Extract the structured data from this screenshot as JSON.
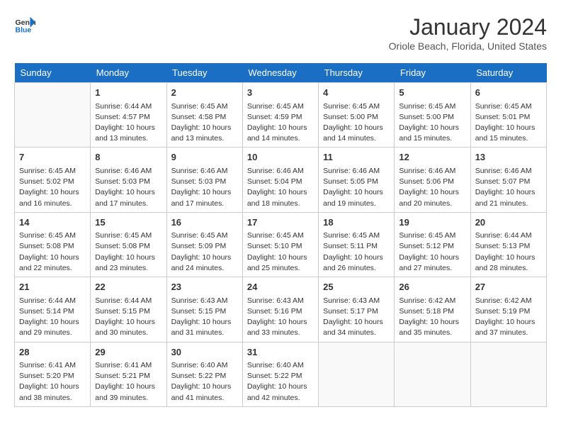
{
  "logo": {
    "text_general": "General",
    "text_blue": "Blue"
  },
  "header": {
    "title": "January 2024",
    "subtitle": "Oriole Beach, Florida, United States"
  },
  "weekdays": [
    "Sunday",
    "Monday",
    "Tuesday",
    "Wednesday",
    "Thursday",
    "Friday",
    "Saturday"
  ],
  "weeks": [
    [
      {
        "day": "",
        "info": ""
      },
      {
        "day": "1",
        "info": "Sunrise: 6:44 AM\nSunset: 4:57 PM\nDaylight: 10 hours\nand 13 minutes."
      },
      {
        "day": "2",
        "info": "Sunrise: 6:45 AM\nSunset: 4:58 PM\nDaylight: 10 hours\nand 13 minutes."
      },
      {
        "day": "3",
        "info": "Sunrise: 6:45 AM\nSunset: 4:59 PM\nDaylight: 10 hours\nand 14 minutes."
      },
      {
        "day": "4",
        "info": "Sunrise: 6:45 AM\nSunset: 5:00 PM\nDaylight: 10 hours\nand 14 minutes."
      },
      {
        "day": "5",
        "info": "Sunrise: 6:45 AM\nSunset: 5:00 PM\nDaylight: 10 hours\nand 15 minutes."
      },
      {
        "day": "6",
        "info": "Sunrise: 6:45 AM\nSunset: 5:01 PM\nDaylight: 10 hours\nand 15 minutes."
      }
    ],
    [
      {
        "day": "7",
        "info": "Sunrise: 6:45 AM\nSunset: 5:02 PM\nDaylight: 10 hours\nand 16 minutes."
      },
      {
        "day": "8",
        "info": "Sunrise: 6:46 AM\nSunset: 5:03 PM\nDaylight: 10 hours\nand 17 minutes."
      },
      {
        "day": "9",
        "info": "Sunrise: 6:46 AM\nSunset: 5:03 PM\nDaylight: 10 hours\nand 17 minutes."
      },
      {
        "day": "10",
        "info": "Sunrise: 6:46 AM\nSunset: 5:04 PM\nDaylight: 10 hours\nand 18 minutes."
      },
      {
        "day": "11",
        "info": "Sunrise: 6:46 AM\nSunset: 5:05 PM\nDaylight: 10 hours\nand 19 minutes."
      },
      {
        "day": "12",
        "info": "Sunrise: 6:46 AM\nSunset: 5:06 PM\nDaylight: 10 hours\nand 20 minutes."
      },
      {
        "day": "13",
        "info": "Sunrise: 6:46 AM\nSunset: 5:07 PM\nDaylight: 10 hours\nand 21 minutes."
      }
    ],
    [
      {
        "day": "14",
        "info": "Sunrise: 6:45 AM\nSunset: 5:08 PM\nDaylight: 10 hours\nand 22 minutes."
      },
      {
        "day": "15",
        "info": "Sunrise: 6:45 AM\nSunset: 5:08 PM\nDaylight: 10 hours\nand 23 minutes."
      },
      {
        "day": "16",
        "info": "Sunrise: 6:45 AM\nSunset: 5:09 PM\nDaylight: 10 hours\nand 24 minutes."
      },
      {
        "day": "17",
        "info": "Sunrise: 6:45 AM\nSunset: 5:10 PM\nDaylight: 10 hours\nand 25 minutes."
      },
      {
        "day": "18",
        "info": "Sunrise: 6:45 AM\nSunset: 5:11 PM\nDaylight: 10 hours\nand 26 minutes."
      },
      {
        "day": "19",
        "info": "Sunrise: 6:45 AM\nSunset: 5:12 PM\nDaylight: 10 hours\nand 27 minutes."
      },
      {
        "day": "20",
        "info": "Sunrise: 6:44 AM\nSunset: 5:13 PM\nDaylight: 10 hours\nand 28 minutes."
      }
    ],
    [
      {
        "day": "21",
        "info": "Sunrise: 6:44 AM\nSunset: 5:14 PM\nDaylight: 10 hours\nand 29 minutes."
      },
      {
        "day": "22",
        "info": "Sunrise: 6:44 AM\nSunset: 5:15 PM\nDaylight: 10 hours\nand 30 minutes."
      },
      {
        "day": "23",
        "info": "Sunrise: 6:43 AM\nSunset: 5:15 PM\nDaylight: 10 hours\nand 31 minutes."
      },
      {
        "day": "24",
        "info": "Sunrise: 6:43 AM\nSunset: 5:16 PM\nDaylight: 10 hours\nand 33 minutes."
      },
      {
        "day": "25",
        "info": "Sunrise: 6:43 AM\nSunset: 5:17 PM\nDaylight: 10 hours\nand 34 minutes."
      },
      {
        "day": "26",
        "info": "Sunrise: 6:42 AM\nSunset: 5:18 PM\nDaylight: 10 hours\nand 35 minutes."
      },
      {
        "day": "27",
        "info": "Sunrise: 6:42 AM\nSunset: 5:19 PM\nDaylight: 10 hours\nand 37 minutes."
      }
    ],
    [
      {
        "day": "28",
        "info": "Sunrise: 6:41 AM\nSunset: 5:20 PM\nDaylight: 10 hours\nand 38 minutes."
      },
      {
        "day": "29",
        "info": "Sunrise: 6:41 AM\nSunset: 5:21 PM\nDaylight: 10 hours\nand 39 minutes."
      },
      {
        "day": "30",
        "info": "Sunrise: 6:40 AM\nSunset: 5:22 PM\nDaylight: 10 hours\nand 41 minutes."
      },
      {
        "day": "31",
        "info": "Sunrise: 6:40 AM\nSunset: 5:22 PM\nDaylight: 10 hours\nand 42 minutes."
      },
      {
        "day": "",
        "info": ""
      },
      {
        "day": "",
        "info": ""
      },
      {
        "day": "",
        "info": ""
      }
    ]
  ]
}
